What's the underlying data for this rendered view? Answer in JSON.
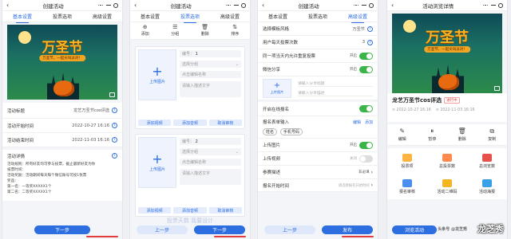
{
  "common": {
    "icon_more": "more-icon",
    "icon_minimize": "minimize-icon",
    "icon_close": "close-circle-icon"
  },
  "screen1": {
    "title": "创建活动",
    "tabs": [
      "基本设置",
      "投票选项",
      "高级设置"
    ],
    "poster": {
      "title": "万圣节",
      "subtitle": "万圣节，一起尖叫派对！"
    },
    "rows": [
      {
        "label": "活动标题",
        "value": "龙艺万圣节cos评选"
      },
      {
        "label": "活动开始时间",
        "value": "2022-10-27 16:16"
      },
      {
        "label": "活动结束时间",
        "value": "2022-11-03 16:16"
      }
    ],
    "details_label": "活动详情",
    "details_text": [
      "活动规则：所有好友均可参与投票，截止最新好友为你",
      "投票时间：",
      "活动奖励：活动期间每天每个微信账号可投1张票",
      "奖品：",
      "第一名：一等奖XXXXX1个",
      "第二名：二等奖XXXXX1个"
    ],
    "next": "下一步"
  },
  "screen2": {
    "title": "创建活动",
    "tabs": [
      "基本设置",
      "投票选项",
      "高级设置"
    ],
    "tools": [
      "添加",
      "分组",
      "删除",
      "排序"
    ],
    "cards": [
      {
        "upload": "上传图片",
        "no_label": "编号：",
        "no": "1",
        "group_ph": "选择分组",
        "name_ph": "点击编辑名称",
        "desc_ph": "请输入描述文字",
        "btns": [
          "添加视频",
          "添加音频",
          "取消审核"
        ]
      },
      {
        "upload": "上传图片",
        "no_label": "编号：",
        "no": "2",
        "group_ph": "选择分组",
        "name_ph": "点击编辑名称",
        "desc_ph": "请输入描述文字",
        "btns": [
          "添加视频",
          "添加音频",
          "取消审核"
        ]
      }
    ],
    "faded": "投票天数   我要设计",
    "prev": "上一步",
    "next": "下一步"
  },
  "screen3": {
    "title": "创建活动",
    "tabs": [
      "基本设置",
      "投票选项",
      "高级设置"
    ],
    "rows": [
      {
        "label": "选择模板风格",
        "value": "万圣节"
      },
      {
        "label": "用户每天投票次数",
        "value": "3"
      },
      {
        "label": "同一项当天内允许重复投票",
        "value": "开启"
      },
      {
        "label": "微信分享",
        "value": "开启"
      }
    ],
    "share_thumb": "上传图片",
    "share_title_ph": "请输入分享标题",
    "share_desc_ph": "请输入分享描述",
    "enroll_label": "开启在线报名",
    "enroll_fields_label": "报名表单输入",
    "enroll_edit": "编辑",
    "enroll_add": "添加",
    "chips": [
      "姓名",
      "手机号码"
    ],
    "upload_img": {
      "label": "上传图片",
      "value": "开启"
    },
    "upload_video": {
      "label": "上传视频",
      "value": "关闭"
    },
    "review": {
      "label": "参赛描述",
      "value": "非必填"
    },
    "enroll_start": {
      "label": "报名开始时间",
      "value": "请选择报名开始时间"
    },
    "prev": "上一步",
    "publish": "发布"
  },
  "screen4": {
    "title": "活动浏览详情",
    "poster": {
      "title": "万圣节",
      "subtitle": "万圣节，一起尖叫派对！"
    },
    "name": "龙艺万圣节cos评选",
    "tag": "进行中",
    "start": "2022-10-27 16:16",
    "end": "2022-11-03 16:16",
    "actions": [
      "编辑",
      "暂停",
      "删除",
      "复制"
    ],
    "grid": [
      "投票项",
      "总投票数",
      "总浏览数",
      "报名审核",
      "活动二维码",
      "活动海报"
    ],
    "browse": "浏览活动",
    "watermark": "龙芝秀",
    "watermark_sub": "头条号 @龙芝秀"
  }
}
